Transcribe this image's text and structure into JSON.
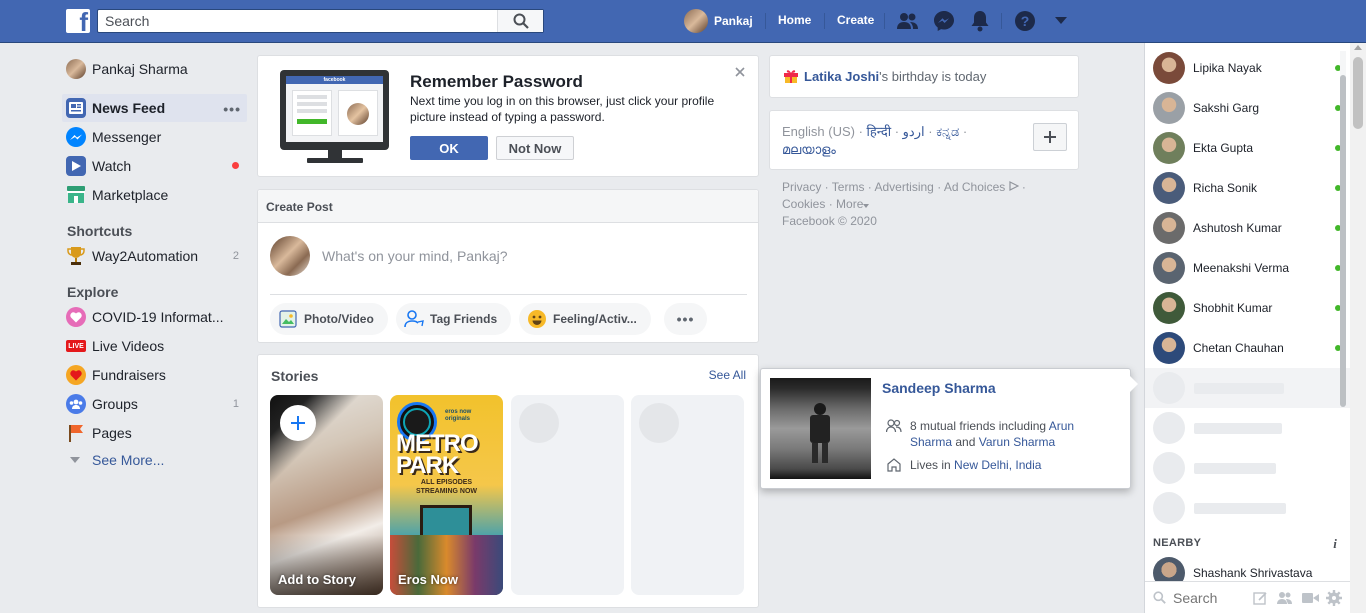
{
  "topbar": {
    "search_placeholder": "Search",
    "user_name": "Pankaj",
    "home_label": "Home",
    "create_label": "Create"
  },
  "left_nav": {
    "profile_name": "Pankaj Sharma",
    "items": [
      {
        "label": "News Feed",
        "icon": "news-feed-icon"
      },
      {
        "label": "Messenger",
        "icon": "messenger-icon"
      },
      {
        "label": "Watch",
        "icon": "watch-icon"
      },
      {
        "label": "Marketplace",
        "icon": "marketplace-icon"
      }
    ],
    "shortcuts_heading": "Shortcuts",
    "shortcuts": [
      {
        "label": "Way2Automation",
        "count": "2",
        "icon": "trophy-icon"
      }
    ],
    "explore_heading": "Explore",
    "explore": [
      {
        "label": "COVID-19 Informat...",
        "count": "",
        "icon": "covid-heart-icon"
      },
      {
        "label": "Live Videos",
        "count": "",
        "icon": "live-icon"
      },
      {
        "label": "Fundraisers",
        "count": "",
        "icon": "fundraiser-icon"
      },
      {
        "label": "Groups",
        "count": "1",
        "icon": "groups-icon"
      },
      {
        "label": "Pages",
        "count": "",
        "icon": "pages-flag-icon"
      }
    ],
    "see_more": "See More..."
  },
  "remember_password": {
    "title": "Remember Password",
    "body": "Next time you log in on this browser, just click your profile picture instead of typing a password.",
    "ok_label": "OK",
    "not_now_label": "Not Now",
    "laptop_brand": "facebook"
  },
  "create_post": {
    "header": "Create Post",
    "placeholder": "What's on your mind, Pankaj?",
    "actions": [
      {
        "label": "Photo/Video",
        "icon": "photo-video-icon"
      },
      {
        "label": "Tag Friends",
        "icon": "tag-friends-icon"
      },
      {
        "label": "Feeling/Activ...",
        "icon": "feeling-icon"
      }
    ]
  },
  "stories": {
    "header": "Stories",
    "see_all": "See All",
    "items": [
      {
        "label": "Add to Story"
      },
      {
        "label": "Eros Now",
        "poster_title": "METRO PARK",
        "poster_line1": "ALL EPISODES",
        "poster_line2": "STREAMING NOW",
        "badge": "eros now originals"
      }
    ]
  },
  "birthday": {
    "name": "Latika Joshi",
    "suffix": "'s birthday is today"
  },
  "languages": {
    "current": "English (US)",
    "others": [
      "हिन्दी",
      "اردو",
      "ಕನ್ನಡ",
      "മലയാളം"
    ]
  },
  "footer": {
    "links": [
      "Privacy",
      "Terms",
      "Advertising",
      "Ad Choices",
      "Cookies",
      "More"
    ],
    "copyright": "Facebook © 2020"
  },
  "hovercard": {
    "name": "Sandeep Sharma",
    "mutual_prefix": "8 mutual friends including ",
    "mutual_friend_1": "Arun Sharma",
    "and_word": " and ",
    "mutual_friend_2": "Varun Sharma",
    "lives_prefix": "Lives in ",
    "city": "New Delhi, India"
  },
  "chat": {
    "contacts": [
      {
        "name": "Lipika Nayak",
        "color": "#7a4a3a"
      },
      {
        "name": "Sakshi Garg",
        "color": "#9aa0a6"
      },
      {
        "name": "Ekta Gupta",
        "color": "#6f7f5c"
      },
      {
        "name": "Richa Sonik",
        "color": "#4a5c7a"
      },
      {
        "name": "Ashutosh Kumar",
        "color": "#6b6b6b"
      },
      {
        "name": "Meenakshi Verma",
        "color": "#5a6470"
      },
      {
        "name": "Shobhit Kumar",
        "color": "#3f5a3a"
      },
      {
        "name": "Chetan Chauhan",
        "color": "#2d4a7a"
      }
    ],
    "nearby_heading": "NEARBY",
    "nearby": [
      {
        "name": "Shashank Shrivastava",
        "color": "#4d5a6b"
      }
    ],
    "search_placeholder": "Search"
  },
  "colors": {
    "brand_blue": "#4267b2",
    "link_blue": "#365899",
    "online_green": "#42b72a",
    "notification_red": "#fa3e3e"
  }
}
